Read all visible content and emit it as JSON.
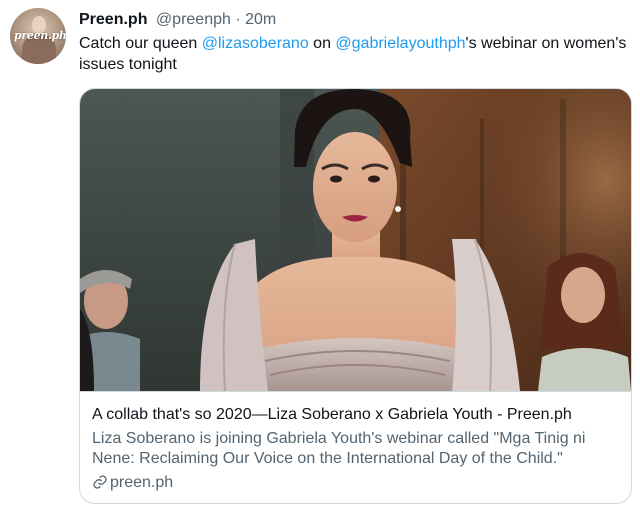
{
  "tweet": {
    "author_name": "Preen.ph",
    "author_handle": "@preenph",
    "separator": "·",
    "time": "20m",
    "avatar_logo_text": "preen.ph",
    "text_parts": [
      {
        "type": "text",
        "value": "Catch our queen "
      },
      {
        "type": "mention",
        "value": "@lizasoberano"
      },
      {
        "type": "text",
        "value": " on "
      },
      {
        "type": "mention",
        "value": "@gabrielayouthph"
      },
      {
        "type": "text",
        "value": "'s webinar on women's issues tonight"
      }
    ]
  },
  "card": {
    "title": "A collab that's so 2020—Liza Soberano x Gabriela Youth - Preen.ph",
    "description": "Liza Soberano is joining Gabriela Youth's webinar called \"Mga Tinig ni Nene: Reclaiming Our Voice on the International Day of the Child.\"",
    "domain": "preen.ph",
    "domain_icon": "link-icon"
  },
  "colors": {
    "mention": "#1d9bf0",
    "secondary_text": "#536471",
    "primary_text": "#0f1419",
    "border": "#cfd9de"
  }
}
